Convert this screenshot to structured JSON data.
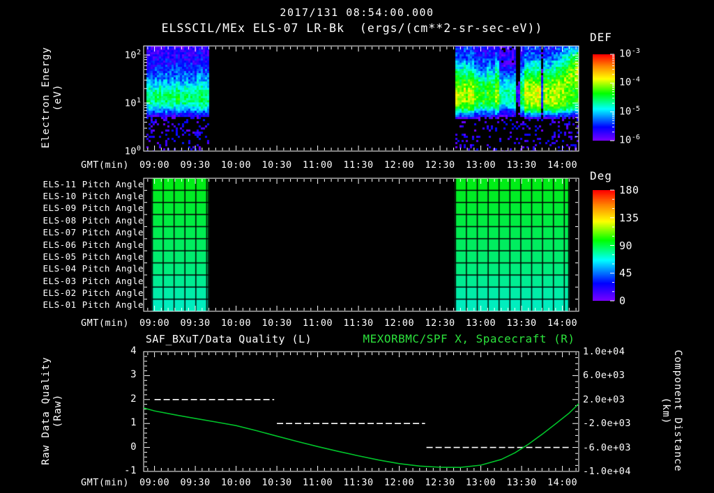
{
  "header": {
    "datetime": "2017/131 08:54:00.000",
    "instrument_title": "ELSSCIL/MEx ELS-07 LR-Bk  (ergs/(cm**2-sr-sec-eV))"
  },
  "xaxis": {
    "label": "GMT(min)",
    "tick_labels": [
      "09:00",
      "09:30",
      "10:00",
      "10:30",
      "11:00",
      "11:30",
      "12:00",
      "12:30",
      "13:00",
      "13:30",
      "14:00"
    ]
  },
  "energy_panel": {
    "ylabel": "Electron Energy\n(eV)",
    "yticks": [
      {
        "base": "10",
        "exp": "2"
      },
      {
        "base": "10",
        "exp": "1"
      },
      {
        "base": "10",
        "exp": "0"
      }
    ],
    "colorbar": {
      "title": "DEF",
      "ticks": [
        {
          "base": "10",
          "exp": "-3"
        },
        {
          "base": "10",
          "exp": "-4"
        },
        {
          "base": "10",
          "exp": "-5"
        },
        {
          "base": "10",
          "exp": "-6"
        }
      ]
    }
  },
  "pitch_panel": {
    "row_labels": [
      "ELS-11 Pitch Angle",
      "ELS-10 Pitch Angle",
      "ELS-09 Pitch Angle",
      "ELS-08 Pitch Angle",
      "ELS-07 Pitch Angle",
      "ELS-06 Pitch Angle",
      "ELS-05 Pitch Angle",
      "ELS-04 Pitch Angle",
      "ELS-03 Pitch Angle",
      "ELS-02 Pitch Angle",
      "ELS-01 Pitch Angle"
    ],
    "colorbar": {
      "title": "Deg",
      "ticks": [
        "180",
        "135",
        "90",
        "45",
        "0"
      ]
    }
  },
  "bottom_panel": {
    "title_left": "SAF_BXuT/Data Quality (L)",
    "title_right": "MEXORBMC/SPF X, Spacecraft (R)",
    "ylabel_left": "Raw Data Quality\n(Raw)",
    "yticks_left": [
      "4",
      "3",
      "2",
      "1",
      "0",
      "-1"
    ],
    "ylabel_right": "Component Distance\n(km)",
    "yticks_right": [
      "1.0e+04",
      "6.0e+03",
      "2.0e+03",
      "-2.0e+03",
      "-6.0e+03",
      "-1.0e+04"
    ]
  },
  "colors": {
    "background": "#000000",
    "foreground": "#ffffff",
    "title_green": "#2ce23c",
    "curve_green": "#00c32a",
    "quality_white": "#ffffff"
  },
  "chart_data": [
    {
      "id": "electron_energy_spectrogram",
      "type": "heatmap",
      "title": "ELSSCIL/MEx ELS-07 LR-Bk",
      "units": "ergs/(cm**2-sr-sec-eV)",
      "x_axis": {
        "label": "GMT(min)",
        "start": "08:52",
        "end": "14:12"
      },
      "y_axis": {
        "label": "Electron Energy (eV)",
        "scale": "log",
        "min_ev": 1,
        "max_ev": 155
      },
      "colorbar": {
        "label": "DEF",
        "log10_flux_range": [
          -6,
          -3
        ]
      },
      "segments": [
        {
          "start_min": 534,
          "end_min": 580,
          "profile_logE_logflux": [
            [
              0,
              -7.5
            ],
            [
              0.55,
              -6.6
            ],
            [
              0.75,
              -5.6
            ],
            [
              0.9,
              -4.9
            ],
            [
              1.05,
              -4.55
            ],
            [
              1.2,
              -4.6
            ],
            [
              1.35,
              -4.9
            ],
            [
              1.5,
              -5.2
            ],
            [
              1.75,
              -5.5
            ],
            [
              2.0,
              -5.65
            ],
            [
              2.2,
              -5.75
            ]
          ],
          "events": [
            {
              "start_min": 534,
              "end_min": 580,
              "delta": 0
            }
          ],
          "high_energy_boost": false
        },
        {
          "start_min": 761,
          "end_min": 852,
          "profile_logE_logflux": [
            [
              0,
              -7.5
            ],
            [
              0.55,
              -6.5
            ],
            [
              0.75,
              -5.5
            ],
            [
              0.9,
              -4.7
            ],
            [
              1.05,
              -4.35
            ],
            [
              1.25,
              -4.35
            ],
            [
              1.45,
              -4.6
            ],
            [
              1.6,
              -4.95
            ],
            [
              1.8,
              -5.35
            ],
            [
              2.0,
              -5.55
            ],
            [
              2.2,
              -5.7
            ]
          ],
          "events": [
            {
              "start_min": 761,
              "end_min": 775,
              "delta": 0.35
            },
            {
              "start_min": 775,
              "end_min": 790,
              "delta": 0.0
            },
            {
              "start_min": 790,
              "end_min": 794,
              "delta": 0.3
            },
            {
              "start_min": 794,
              "end_min": 806,
              "delta": -0.4
            },
            {
              "start_min": 806,
              "end_min": 809,
              "delta": -1.4
            },
            {
              "start_min": 809,
              "end_min": 812,
              "delta": -0.1
            },
            {
              "start_min": 812,
              "end_min": 825,
              "delta": 0.45
            },
            {
              "start_min": 825,
              "end_min": 826,
              "delta": -0.9
            },
            {
              "start_min": 826,
              "end_min": 843,
              "delta": 0.35
            },
            {
              "start_min": 843,
              "end_min": 852,
              "delta": 0.1
            }
          ],
          "high_energy_boost": true
        }
      ]
    },
    {
      "id": "pitch_angle_panel",
      "type": "heatmap",
      "rows_top_to_bottom": [
        "ELS-11",
        "ELS-10",
        "ELS-09",
        "ELS-08",
        "ELS-07",
        "ELS-06",
        "ELS-05",
        "ELS-04",
        "ELS-03",
        "ELS-02",
        "ELS-01"
      ],
      "rows_top_to_bottom_deg": [
        96,
        94,
        92,
        90,
        88,
        86,
        84,
        82,
        79,
        76,
        73
      ],
      "deg_range": [
        0,
        180
      ],
      "cell_minutes": 8,
      "segments": [
        {
          "start_min": 538,
          "end_min": 580
        },
        {
          "start_min": 761,
          "end_min": 845
        }
      ]
    },
    {
      "id": "quality_distance",
      "type": "line",
      "title_left": "SAF_BXuT/Data Quality (L)",
      "title_right": "MEXORBMC/SPF X, Spacecraft (R)",
      "left_axis": {
        "label": "Raw Data Quality (Raw)",
        "min": -1,
        "max": 4,
        "ticks": [
          4,
          3,
          2,
          1,
          0,
          -1
        ]
      },
      "right_axis": {
        "label": "Component Distance (km)",
        "min": -10000,
        "max": 10000,
        "ticks": [
          10000,
          6000,
          2000,
          -2000,
          -6000,
          -10000
        ]
      },
      "series": [
        {
          "name": "SAF_BXuT/Data Quality",
          "axis": "left",
          "style": "dashed",
          "color": "#ffffff",
          "steps": [
            {
              "start_min": 540,
              "end_min": 628,
              "value": 2
            },
            {
              "start_min": 630,
              "end_min": 739,
              "value": 1
            },
            {
              "start_min": 740,
              "end_min": 845,
              "value": 0
            }
          ]
        },
        {
          "name": "MEXORBMC/SPF X Spacecraft",
          "axis": "right",
          "style": "solid",
          "color": "#00c32a",
          "points_min_km": [
            [
              532,
              600
            ],
            [
              540,
              100
            ],
            [
              555,
              -550
            ],
            [
              570,
              -1150
            ],
            [
              585,
              -1750
            ],
            [
              600,
              -2350
            ],
            [
              615,
              -3200
            ],
            [
              630,
              -4100
            ],
            [
              645,
              -5000
            ],
            [
              660,
              -5850
            ],
            [
              675,
              -6650
            ],
            [
              690,
              -7400
            ],
            [
              705,
              -8100
            ],
            [
              720,
              -8700
            ],
            [
              735,
              -9100
            ],
            [
              750,
              -9300
            ],
            [
              765,
              -9320
            ],
            [
              780,
              -8950
            ],
            [
              795,
              -8000
            ],
            [
              805,
              -6900
            ],
            [
              815,
              -5450
            ],
            [
              825,
              -3800
            ],
            [
              835,
              -2050
            ],
            [
              845,
              -250
            ],
            [
              852,
              1300
            ]
          ]
        }
      ]
    }
  ]
}
